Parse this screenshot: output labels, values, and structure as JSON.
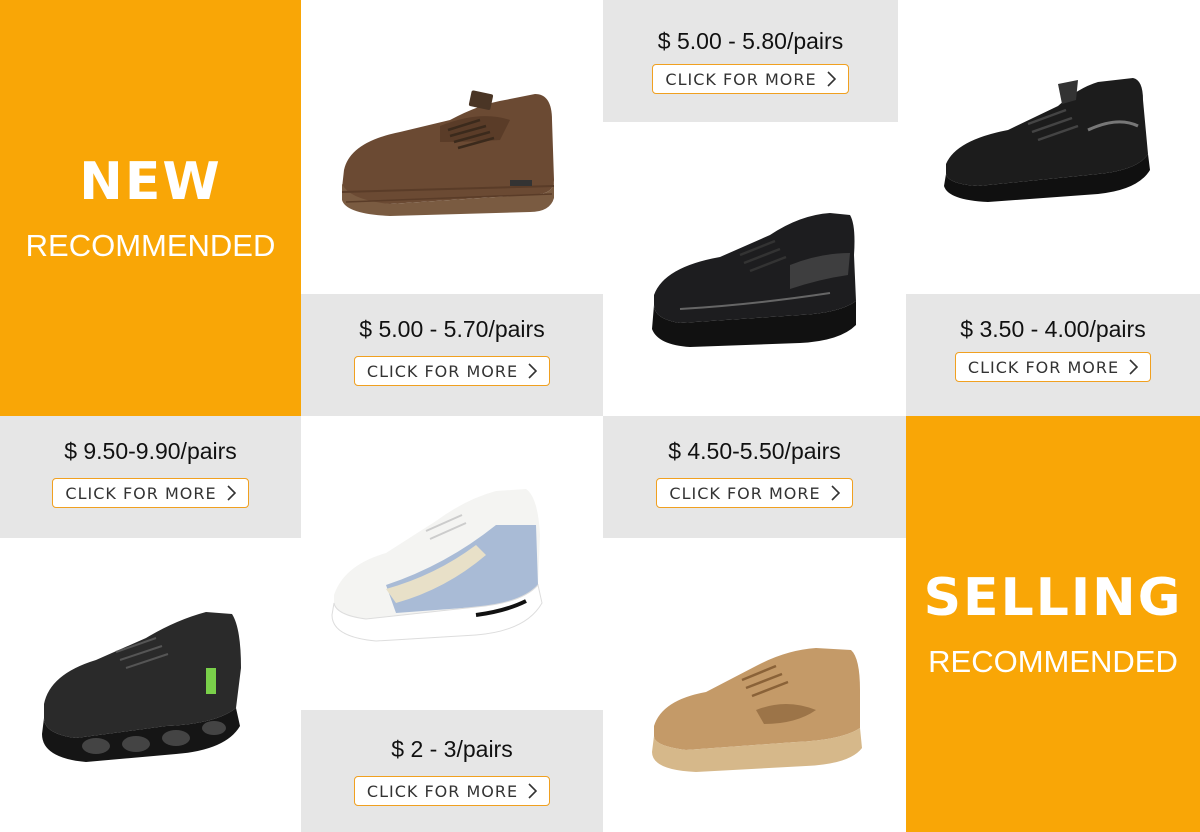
{
  "banners": {
    "new": {
      "title": "NEW",
      "subtitle": "RECOMMENDED"
    },
    "selling": {
      "title": "SELLING",
      "subtitle": "RECOMMENDED"
    }
  },
  "products": [
    {
      "id": "brown-leather",
      "price": "$ 5.00 - 5.70/pairs",
      "button": "CLICK FOR MORE"
    },
    {
      "id": "black-runner",
      "price": "$ 5.00 - 5.80/pairs",
      "button": "CLICK FOR MORE"
    },
    {
      "id": "black-slipon",
      "price": "$ 3.50 - 4.00/pairs",
      "button": "CLICK FOR MORE"
    },
    {
      "id": "black-knit",
      "price": "$ 9.50-9.90/pairs",
      "button": "CLICK FOR MORE"
    },
    {
      "id": "white-blue",
      "price": "$ 2 - 3/pairs",
      "button": "CLICK FOR MORE"
    },
    {
      "id": "tan-sneaker",
      "price": "$ 4.50-5.50/pairs",
      "button": "CLICK FOR MORE"
    }
  ],
  "colors": {
    "accent": "#f9a606",
    "panel": "#e6e6e6",
    "button_border": "#f0a020"
  },
  "icons": {
    "button_arrow": "chevron-right-icon"
  }
}
